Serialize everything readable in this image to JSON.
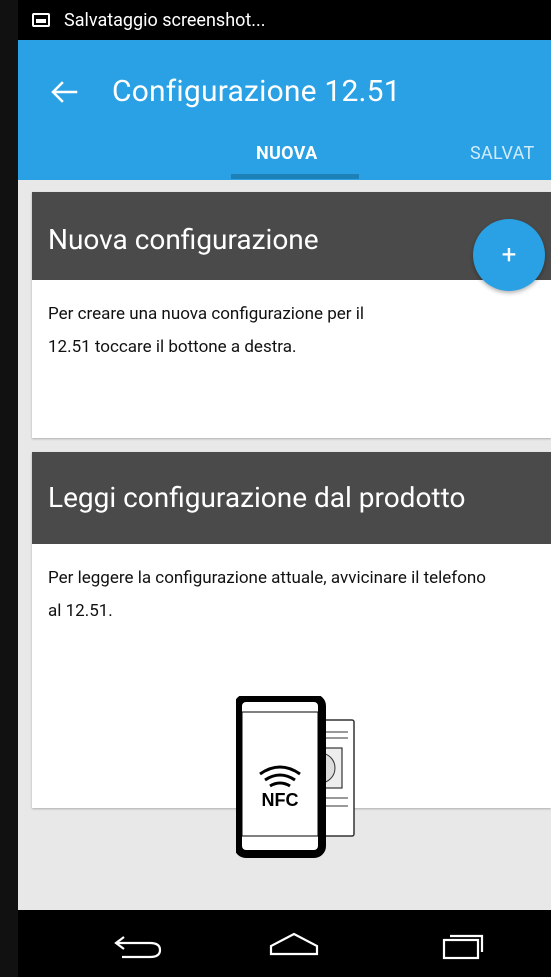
{
  "status_bar": {
    "text": "Salvataggio screenshot..."
  },
  "app_bar": {
    "title": "Configurazione 12.51"
  },
  "tabs": [
    {
      "label": "NUOVA",
      "selected": true
    },
    {
      "label": "SALVAT",
      "selected": false
    }
  ],
  "cards": {
    "new_config": {
      "title": "Nuova configurazione",
      "body_line1": "Per creare una nuova configurazione per il",
      "body_line2": "12.51 toccare il bottone a destra.",
      "fab_label": "+"
    },
    "read_config": {
      "title": "Leggi configurazione dal prodotto",
      "body_line1": "Per leggere la configurazione attuale, avvicinare il telefono",
      "body_line2": "al 12.51.",
      "illustration_label": "NFC"
    }
  },
  "colors": {
    "primary": "#2aa1e4",
    "header_dark": "#4a4a4a",
    "tab_indicator": "#1d80b7"
  }
}
